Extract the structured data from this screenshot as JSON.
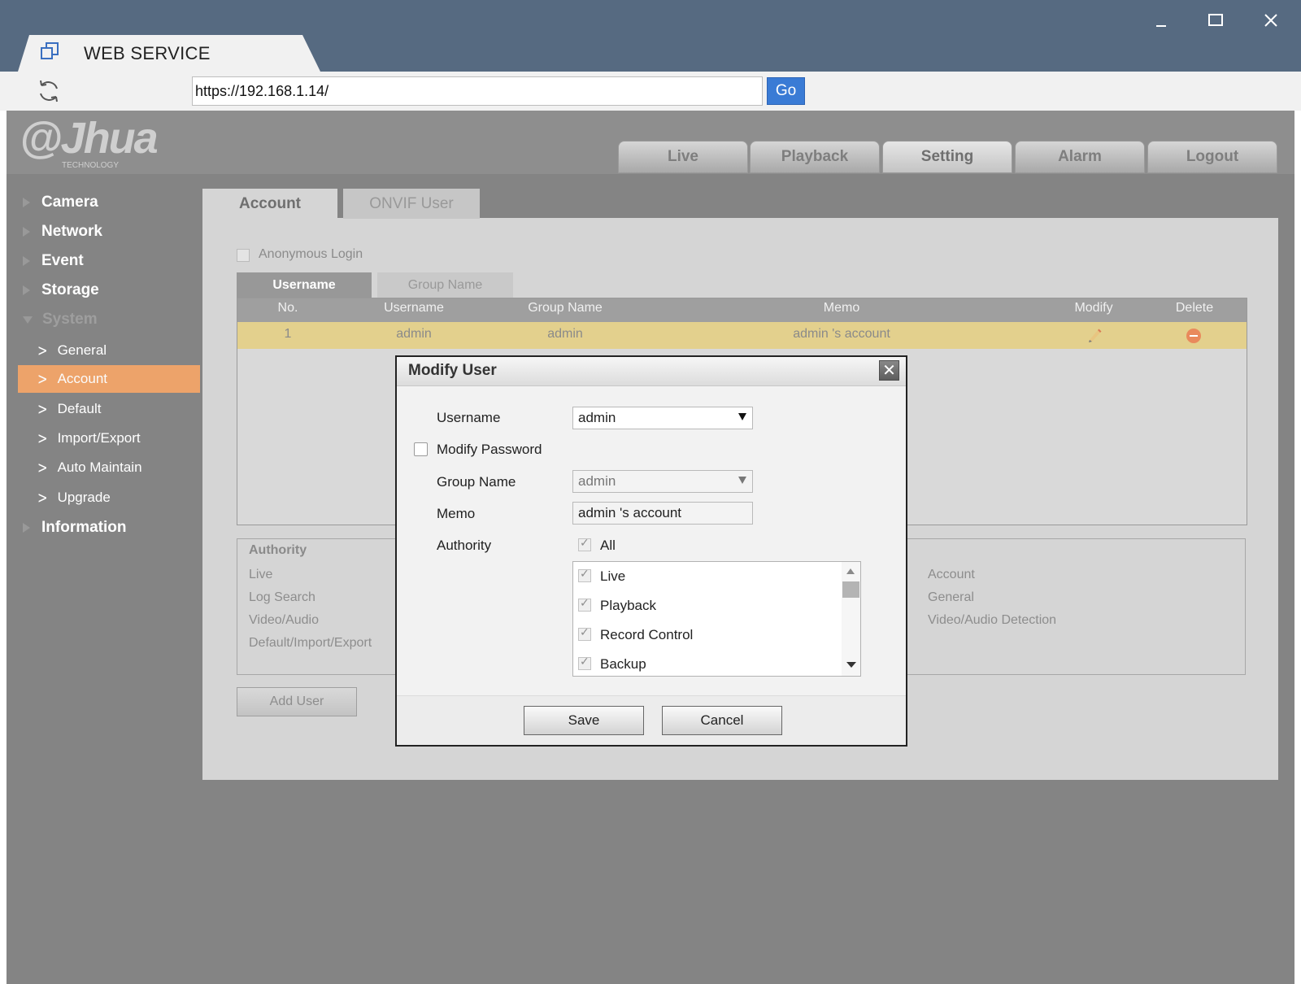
{
  "window": {
    "tab_title": "WEB SERVICE",
    "url": "https://192.168.1.14/",
    "go_label": "Go",
    "controls": [
      "minimize-icon",
      "maximize-icon",
      "close-icon"
    ]
  },
  "brand": {
    "logo_text": "alhua",
    "logo_sub": "TECHNOLOGY"
  },
  "topnav": [
    {
      "label": "Live"
    },
    {
      "label": "Playback"
    },
    {
      "label": "Setting",
      "active": true
    },
    {
      "label": "Alarm"
    },
    {
      "label": "Logout"
    }
  ],
  "sidebar": {
    "top": [
      "Camera",
      "Network",
      "Event",
      "Storage",
      "System",
      "Information"
    ],
    "system_items": [
      "General",
      "Account",
      "Default",
      "Import/Export",
      "Auto Maintain",
      "Upgrade"
    ],
    "active": "Account"
  },
  "tabs": [
    "Account",
    "ONVIF User"
  ],
  "anonymous_login": "Anonymous Login",
  "subtabs": [
    "Username",
    "Group Name"
  ],
  "table": {
    "headers": [
      "No.",
      "Username",
      "Group Name",
      "Memo",
      "Modify",
      "Delete"
    ],
    "rows": [
      {
        "no": "1",
        "username": "admin",
        "group": "admin",
        "memo": "admin 's account"
      }
    ]
  },
  "authority_panel": {
    "title": "Authority",
    "left": [
      "Live",
      "Log Search",
      "Video/Audio",
      "Default/Import/Export"
    ],
    "right": [
      "Account",
      "General",
      "Video/Audio Detection"
    ]
  },
  "add_user": "Add User",
  "modal": {
    "title": "Modify User",
    "username_label": "Username",
    "username_value": "admin",
    "modify_password_label": "Modify Password",
    "modify_password_checked": false,
    "group_label": "Group Name",
    "group_value": "admin",
    "memo_label": "Memo",
    "memo_value": "admin 's account",
    "authority_label": "Authority",
    "all_label": "All",
    "authorities": [
      "Live",
      "Playback",
      "Record Control",
      "Backup"
    ],
    "save": "Save",
    "cancel": "Cancel"
  },
  "colors": {
    "titlebar": "#566a81",
    "go_button": "#3a7bd5",
    "active_menu": "#eda36a",
    "selected_row": "#e3d08d"
  }
}
